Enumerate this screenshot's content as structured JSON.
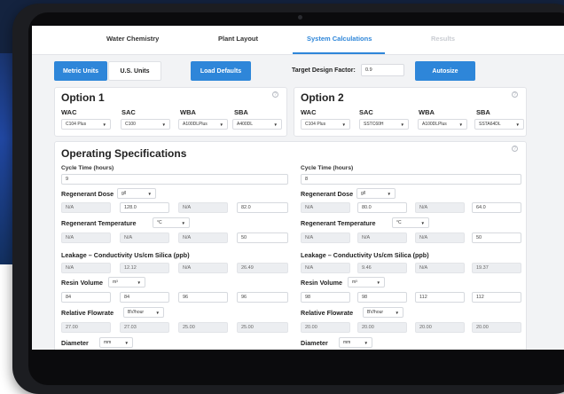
{
  "tabs": [
    "Water Chemistry",
    "Plant Layout",
    "System Calculations",
    "Results"
  ],
  "controls": {
    "metric_units": "Metric Units",
    "us_units": "U.S. Units",
    "load_defaults": "Load Defaults",
    "target_label": "Target Design Factor:",
    "target_value": "0.9",
    "autosize": "Autosize"
  },
  "option1": {
    "title": "Option 1",
    "headers": [
      "WAC",
      "SAC",
      "WBA",
      "SBA"
    ],
    "resins": [
      "C104 Plus",
      "C100",
      "A100DLPlus",
      "A400DL"
    ]
  },
  "option2": {
    "title": "Option 2",
    "headers": [
      "WAC",
      "SAC",
      "WBA",
      "SBA"
    ],
    "resins": [
      "C104 Plus",
      "SSTC60H",
      "A100DLPlus",
      "SSTA64DL"
    ]
  },
  "specs": {
    "title": "Operating Specifications",
    "cycle_label": "Cycle Time (hours)",
    "cycle_left": "9",
    "cycle_right": "8",
    "regen_dose_label": "Regenerant Dose",
    "regen_dose_unit": "g/l",
    "regen_dose_left": [
      "N/A",
      "128.0",
      "N/A",
      "82.0"
    ],
    "regen_dose_right": [
      "N/A",
      "80.0",
      "N/A",
      "64.0"
    ],
    "regen_temp_label": "Regenerant Temperature",
    "regen_temp_unit": "°C",
    "regen_temp_left": [
      "N/A",
      "N/A",
      "N/A",
      "50"
    ],
    "regen_temp_right": [
      "N/A",
      "N/A",
      "N/A",
      "50"
    ],
    "leakage_label": "Leakage – Conductivity Us/cm Silica (ppb)",
    "leakage_left": [
      "N/A",
      "12.12",
      "N/A",
      "26.49"
    ],
    "leakage_right": [
      "N/A",
      "9.46",
      "N/A",
      "19.37"
    ],
    "resin_vol_label": "Resin Volume",
    "resin_vol_unit": "m³",
    "resin_vol_left": [
      "84",
      "84",
      "96",
      "96"
    ],
    "resin_vol_right": [
      "98",
      "98",
      "112",
      "112"
    ],
    "flowrate_label": "Relative Flowrate",
    "flowrate_unit": "BV/hour",
    "flowrate_left": [
      "27.00",
      "27.03",
      "25.00",
      "25.00"
    ],
    "flowrate_right": [
      "20.00",
      "20.00",
      "20.00",
      "20.00"
    ],
    "diameter_label": "Diameter",
    "diameter_unit": "mm"
  },
  "icons": {
    "help": "help-circle-icon",
    "caret": "caret-down-icon"
  }
}
